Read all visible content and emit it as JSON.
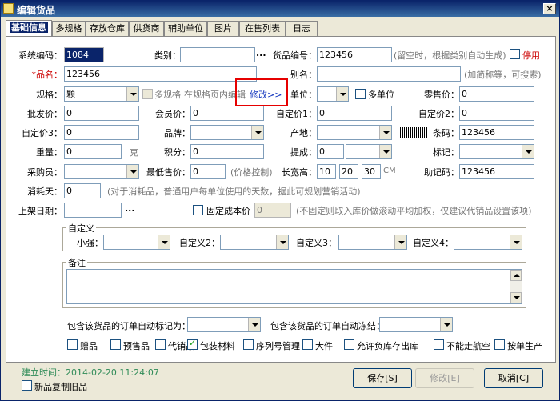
{
  "window": {
    "title": "编辑货品",
    "close": "×"
  },
  "tabs": [
    "基础信息",
    "多规格",
    "存放仓库",
    "供货商",
    "辅助单位",
    "图片",
    "在售列表",
    "日志"
  ],
  "form": {
    "sys_code_label": "系统编码：",
    "sys_code": "1084",
    "category_label": "类别：",
    "category": "",
    "dots": "...",
    "goods_no_label": "货品编号：",
    "goods_no": "123456",
    "goods_no_hint": "(留空时，根据类别自动生成)",
    "stop_label": "停用",
    "name_label": "*品名：",
    "name": "123456",
    "alias_label": "别名：",
    "alias": "",
    "alias_hint": "(加简称等，可搜索)",
    "spec_label": "规格：",
    "spec": "颗",
    "multi_spec_label": "多规格",
    "multi_spec_hint": "在规格页内编辑",
    "modify_link": "修改>>",
    "unit_label": "单位：",
    "unit": "",
    "multi_unit_label": "多单位",
    "retail_label": "零售价：",
    "retail": "0",
    "wholesale_label": "批发价：",
    "wholesale": "0",
    "member_label": "会员价：",
    "member": "0",
    "custom1_label": "自定价1：",
    "custom1": "0",
    "custom2_label": "自定价2：",
    "custom2": "0",
    "custom3_label": "自定价3：",
    "custom3": "0",
    "brand_label": "品牌：",
    "brand": "",
    "origin_label": "产地：",
    "origin": "",
    "barcode_label": "条码：",
    "barcode": "123456",
    "weight_label": "重量：",
    "weight": "0",
    "weight_unit": "克",
    "points_label": "积分：",
    "points": "0",
    "commission_label": "提成：",
    "commission": "0",
    "commission_type": "",
    "mark_label": "标记：",
    "mark": "",
    "buyer_label": "采购员：",
    "buyer": "",
    "min_price_label": "最低售价：",
    "min_price": "0",
    "min_price_hint": "(价格控制)",
    "lwh_label": "长宽高：",
    "length": "10",
    "width": "20",
    "height": "30",
    "lwh_unit": "CM",
    "memo_code_label": "助记码：",
    "memo_code": "123456",
    "consume_days_label": "消耗天：",
    "consume_days": "0",
    "consume_days_hint": "(对于消耗品，普通用户每单位使用的天数，据此可规划营销活动)",
    "shelf_date_label": "上架日期：",
    "shelf_date": "",
    "fixed_cost_label": "固定成本价",
    "fixed_cost": "0",
    "fixed_cost_hint": "(不固定则取入库价做滚动平均加权，仅建议代销品设置该项)"
  },
  "custom_group": {
    "title": "自定义",
    "f1_label": "小强：",
    "f2_label": "自定义2：",
    "f3_label": "自定义3：",
    "f4_label": "自定义4："
  },
  "remark": {
    "title": "备注",
    "value": ""
  },
  "order": {
    "auto_mark_label": "包含该货品的订单自动标记为：",
    "auto_mark": "",
    "auto_freeze_label": "包含该货品的订单自动冻结：",
    "auto_freeze": ""
  },
  "flags": [
    {
      "label": "赠品",
      "checked": false
    },
    {
      "label": "预售品",
      "checked": false
    },
    {
      "label": "代销品",
      "checked": false
    },
    {
      "label": "包装材料",
      "checked": true
    },
    {
      "label": "序列号管理",
      "checked": false
    },
    {
      "label": "大件",
      "checked": false
    },
    {
      "label": "允许负库存出库",
      "checked": false
    },
    {
      "label": "不能走航空",
      "checked": false
    },
    {
      "label": "按单生产",
      "checked": false
    }
  ],
  "footer": {
    "created": "建立时间：2014-02-20 11:24:07",
    "copy_old_label": "新品复制旧品",
    "save": "保存[S]",
    "modify": "修改[E]",
    "cancel": "取消[C]"
  }
}
